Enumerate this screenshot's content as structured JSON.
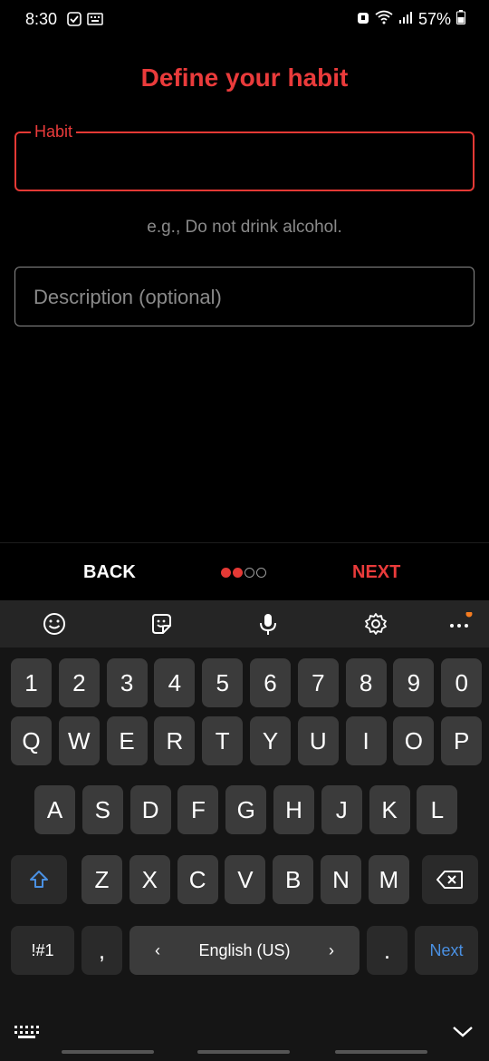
{
  "status": {
    "time": "8:30",
    "battery": "57%"
  },
  "title": "Define your habit",
  "habit": {
    "label": "Habit",
    "value": ""
  },
  "helper": "e.g., Do not drink alcohol.",
  "description": {
    "placeholder": "Description (optional)"
  },
  "nav": {
    "back": "BACK",
    "next": "NEXT",
    "step": 1,
    "total_steps": 4
  },
  "keyboard": {
    "toolbar": [
      "emoji-icon",
      "sticker-icon",
      "microphone-icon",
      "settings-gear-icon",
      "more-options-icon"
    ],
    "row_numbers": [
      "1",
      "2",
      "3",
      "4",
      "5",
      "6",
      "7",
      "8",
      "9",
      "0"
    ],
    "row_q": [
      "Q",
      "W",
      "E",
      "R",
      "T",
      "Y",
      "U",
      "I",
      "O",
      "P"
    ],
    "row_a": [
      "A",
      "S",
      "D",
      "F",
      "G",
      "H",
      "J",
      "K",
      "L"
    ],
    "row_z": [
      "Z",
      "X",
      "C",
      "V",
      "B",
      "N",
      "M"
    ],
    "symbols": "!#1",
    "comma": ",",
    "language": "English (US)",
    "period": ".",
    "action": "Next"
  },
  "colors": {
    "accent": "#e53935",
    "key_action": "#4a90e2"
  }
}
